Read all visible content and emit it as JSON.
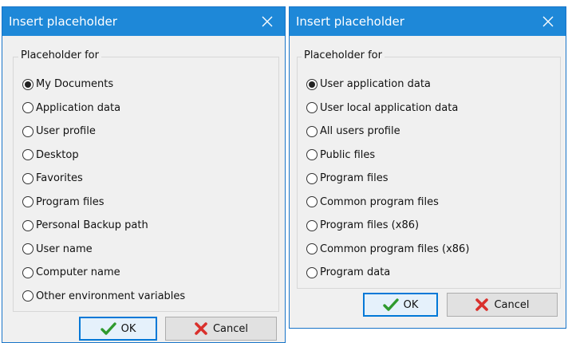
{
  "dialog_left": {
    "title": "Insert placeholder",
    "group_label": "Placeholder for",
    "options": [
      {
        "label": "My Documents",
        "checked": true
      },
      {
        "label": "Application data",
        "checked": false
      },
      {
        "label": "User profile",
        "checked": false
      },
      {
        "label": "Desktop",
        "checked": false
      },
      {
        "label": "Favorites",
        "checked": false
      },
      {
        "label": "Program files",
        "checked": false
      },
      {
        "label": "Personal Backup path",
        "checked": false
      },
      {
        "label": "User name",
        "checked": false
      },
      {
        "label": "Computer name",
        "checked": false
      },
      {
        "label": "Other environment variables",
        "checked": false
      }
    ],
    "ok_label": "OK",
    "cancel_label": "Cancel"
  },
  "dialog_right": {
    "title": "Insert placeholder",
    "group_label": "Placeholder for",
    "options": [
      {
        "label": "User application data",
        "checked": true
      },
      {
        "label": "User local application data",
        "checked": false
      },
      {
        "label": "All users profile",
        "checked": false
      },
      {
        "label": "Public files",
        "checked": false
      },
      {
        "label": "Program files",
        "checked": false
      },
      {
        "label": "Common program files",
        "checked": false
      },
      {
        "label": "Program files (x86)",
        "checked": false
      },
      {
        "label": "Common program files (x86)",
        "checked": false
      },
      {
        "label": "Program data",
        "checked": false
      }
    ],
    "ok_label": "OK",
    "cancel_label": "Cancel"
  },
  "icons": {
    "close": "close-icon",
    "ok": "checkmark-icon",
    "cancel": "red-x-icon"
  },
  "colors": {
    "titlebar": "#1e88d8",
    "dialog_border": "#1874c8",
    "focus_border": "#0078d7",
    "ok_check": "#2e9a2e",
    "cancel_x": "#d9302c"
  }
}
